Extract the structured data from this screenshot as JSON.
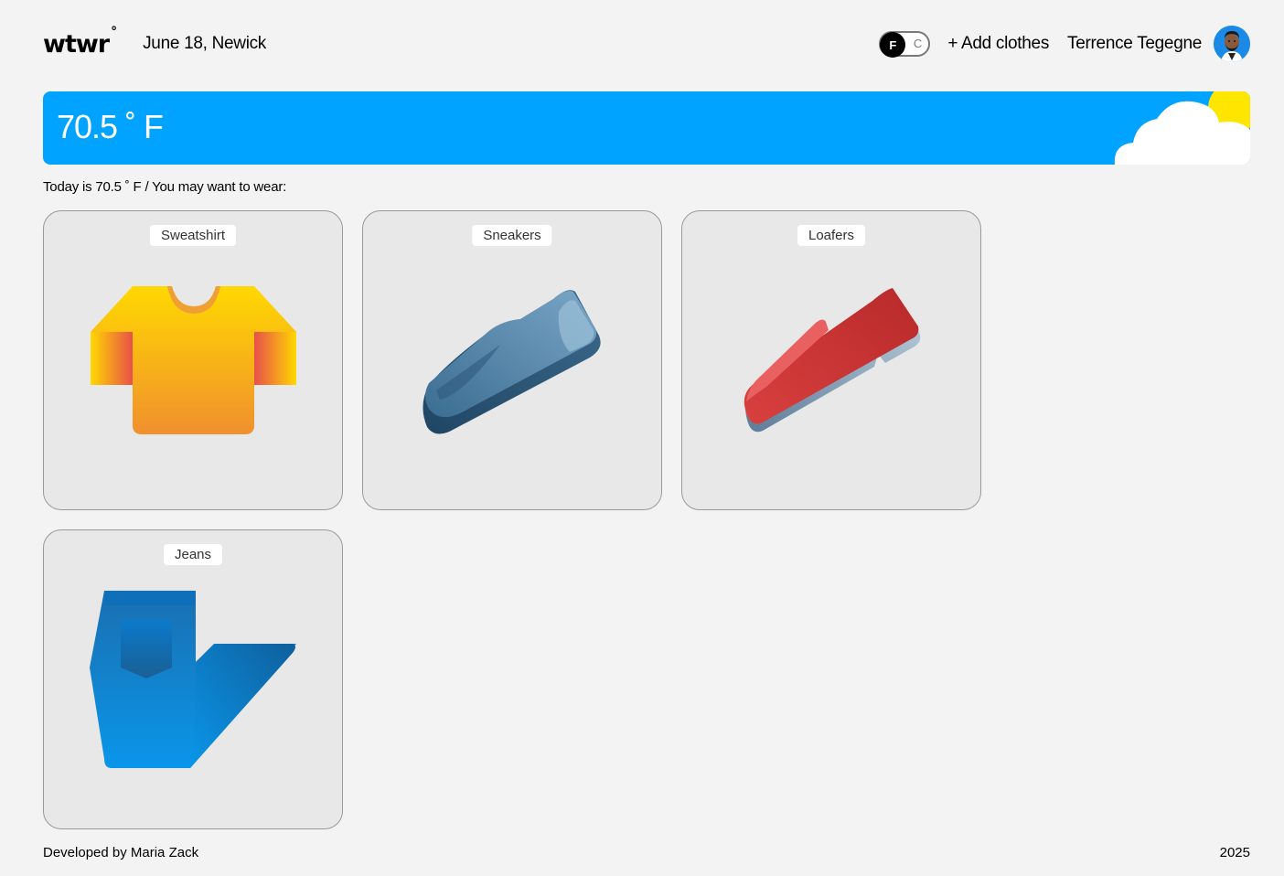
{
  "header": {
    "logo": "wtwr",
    "logo_mark": "°",
    "date_location": "June 18, Newick",
    "unit_toggle": {
      "active": "F",
      "inactive": "C"
    },
    "add_clothes": "+ Add clothes",
    "user_name": "Terrence Tegegne"
  },
  "weather": {
    "temperature": "70.5 ˚ F",
    "condition_icons": [
      "sun-icon",
      "cloud-icon"
    ],
    "banner_color": "#00a3ff"
  },
  "recommendation": "Today is 70.5 ˚ F / You may want to wear:",
  "items": [
    {
      "label": "Sweatshirt",
      "icon": "sweatshirt-icon"
    },
    {
      "label": "Sneakers",
      "icon": "sneaker-icon"
    },
    {
      "label": "Loafers",
      "icon": "loafer-icon"
    },
    {
      "label": "Jeans",
      "icon": "jeans-icon"
    }
  ],
  "footer": {
    "credit": "Developed by Maria Zack",
    "year": "2025"
  }
}
